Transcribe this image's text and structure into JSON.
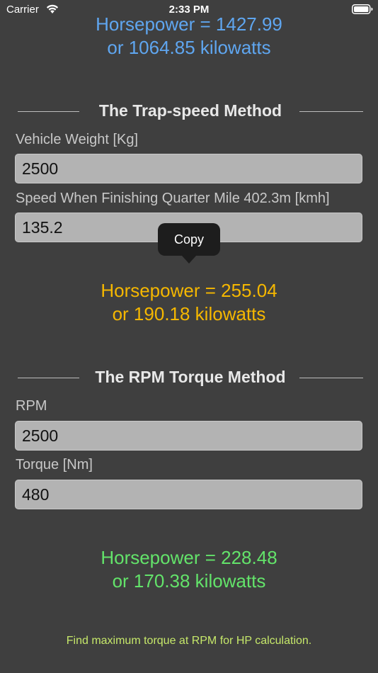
{
  "status_bar": {
    "carrier": "Carrier",
    "time": "2:33 PM"
  },
  "top_result": {
    "horsepower": "Horsepower = 1427.99",
    "kilowatts": "or 1064.85 kilowatts",
    "color": "#5fa6f0"
  },
  "trap_speed": {
    "title": "The Trap-speed Method",
    "weight_label": "Vehicle Weight [Kg]",
    "weight_value": "2500",
    "speed_label": "Speed When Finishing Quarter Mile 402.3m [kmh]",
    "speed_value": "135.2",
    "result_horsepower": "Horsepower = 255.04",
    "result_kilowatts": "or 190.18 kilowatts",
    "result_color": "#f5b700"
  },
  "tooltip": {
    "label": "Copy"
  },
  "rpm_torque": {
    "title": "The RPM Torque Method",
    "rpm_label": "RPM",
    "rpm_value": "2500",
    "torque_label": "Torque [Nm]",
    "torque_value": "480",
    "result_horsepower": "Horsepower = 228.48",
    "result_kilowatts": "or 170.38 kilowatts",
    "result_color": "#63e36a"
  },
  "footer": {
    "hint": "Find maximum torque at RPM for HP calculation.",
    "color": "#c6e86a"
  }
}
